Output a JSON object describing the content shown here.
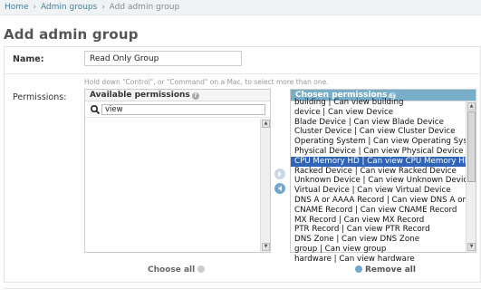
{
  "breadcrumbs": {
    "home": "Home",
    "separator": "›",
    "section": "Admin groups",
    "current": "Add admin group"
  },
  "page": {
    "title": "Add admin group"
  },
  "name_field": {
    "label": "Name:",
    "value": "Read Only Group"
  },
  "permissions": {
    "label": "Permissions:",
    "help_text": "Hold down \"Control\", or \"Command\" on a Mac, to select more than one.",
    "available": {
      "title": "Available permissions",
      "filter_value": "view",
      "options": []
    },
    "chosen": {
      "title": "Chosen permissions",
      "options": [
        "building | Can view building",
        "device | Can view Device",
        "Blade Device | Can view Blade Device",
        "Cluster Device | Can view Cluster Device",
        "Operating System | Can view Operating System",
        "Physical Device | Can view Physical Device",
        "CPU Memory HD | Can view CPU Memory HD",
        "Racked Device | Can view Racked Device",
        "Unknown Device | Can view Unknown Device",
        "Virtual Device | Can view Virtual Device",
        "DNS A or AAAA Record | Can view DNS A or AAAA Record",
        "CNAME Record | Can view CNAME Record",
        "MX Record | Can view MX Record",
        "PTR Record | Can view PTR Record",
        "DNS Zone | Can view DNS Zone",
        "group | Can view group",
        "hardware | Can view hardware"
      ],
      "selected_index": 6
    },
    "choose_all": "Choose all",
    "remove_all": "Remove all"
  },
  "colors": {
    "link": "#447e9b",
    "chosen_header": "#79aec8",
    "selected_option": "#2f64b8"
  },
  "icons": [
    "help-icon",
    "search-icon",
    "add-arrow-icon",
    "remove-arrow-icon",
    "choose-all-icon",
    "remove-all-icon"
  ]
}
